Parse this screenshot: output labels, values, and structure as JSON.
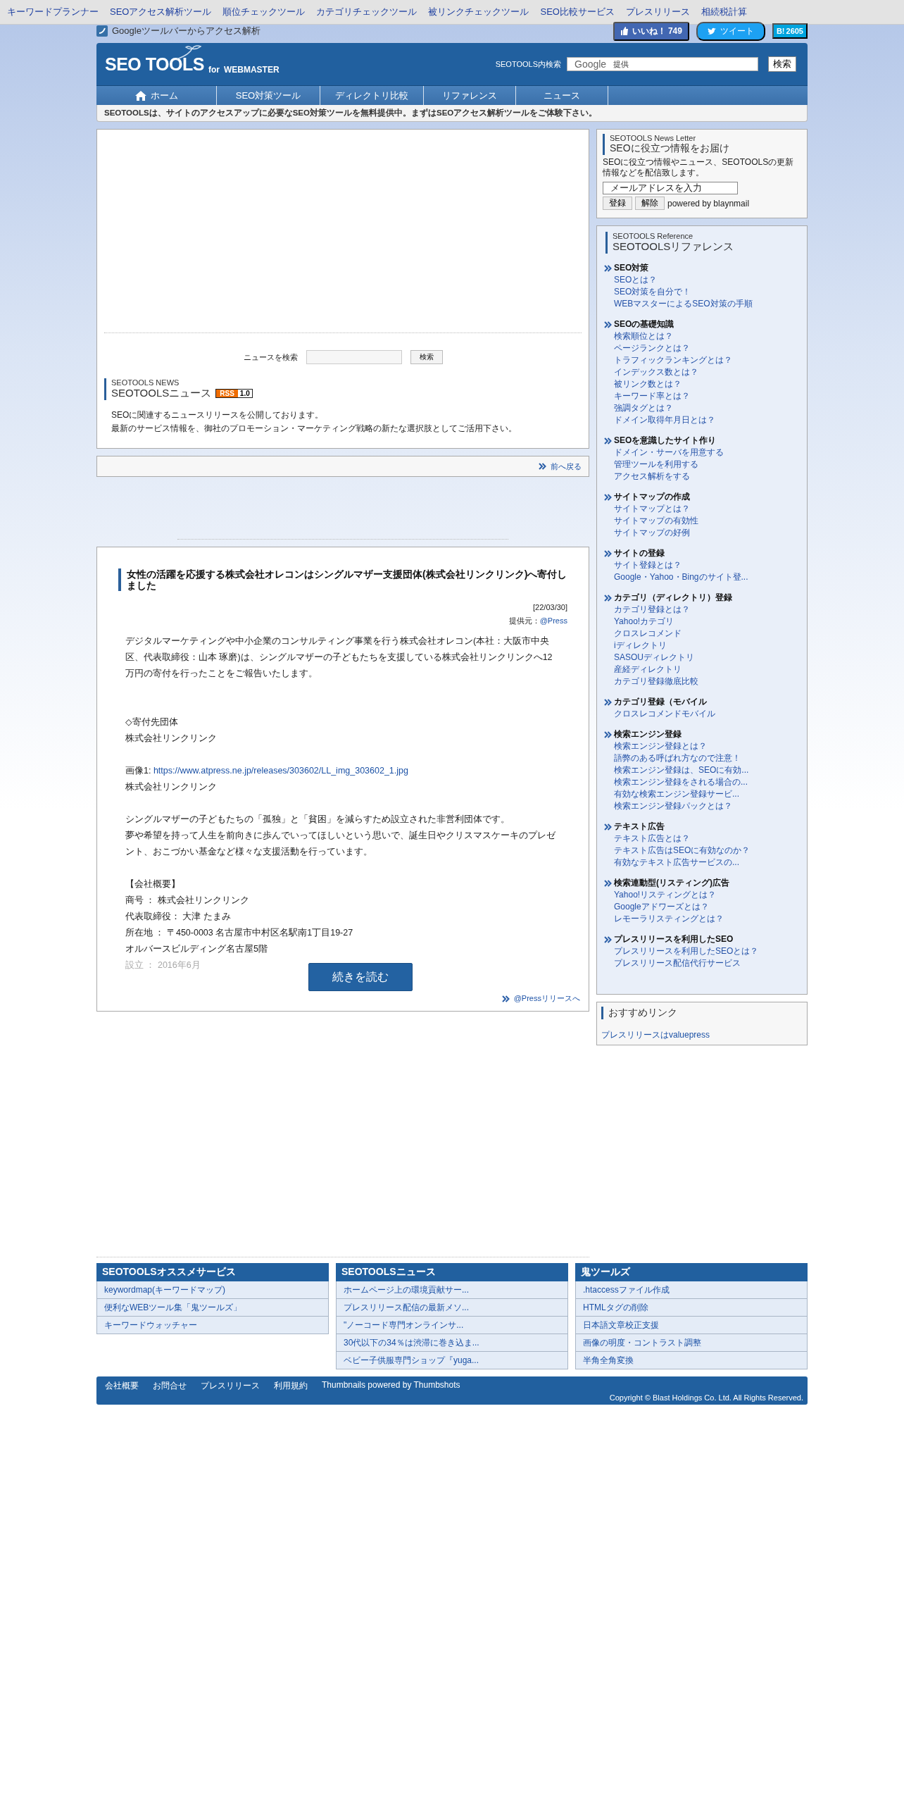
{
  "top_links": [
    "キーワードプランナー",
    "SEOアクセス解析ツール",
    "順位チェックツール",
    "カテゴリチェックツール",
    "被リンクチェックツール",
    "SEO比較サービス",
    "プレスリリース",
    "相続税計算"
  ],
  "toolbar_link": "Googleツールバーからアクセス解析",
  "social": {
    "like_label": "いいね！",
    "like_count": "749",
    "tweet_label": "ツイート",
    "hatena_label": "B!",
    "hatena_count": "2605"
  },
  "header": {
    "logo_title": "SEO TOOLS",
    "logo_for": "for",
    "logo_sub": "WEBMASTER",
    "search_label": "SEOTOOLS内検索",
    "search_brand": "Google",
    "search_hint": "提供",
    "search_button": "検索"
  },
  "nav": [
    {
      "label": "ホーム",
      "kind": "home"
    },
    {
      "label": "SEO対策ツール",
      "kind": "plain"
    },
    {
      "label": "ディレクトリ比較",
      "kind": "plain"
    },
    {
      "label": "リファレンス",
      "kind": "plain"
    },
    {
      "label": "ニュース",
      "kind": "plain"
    }
  ],
  "tagline": "SEOTOOLSは、サイトのアクセスアップに必要なSEO対策ツールを無料提供中。まずはSEOアクセス解析ツールをご体験下さい。",
  "news_search": {
    "label": "ニュースを検索",
    "button": "検索"
  },
  "news_heading": {
    "small": "SEOTOOLS NEWS",
    "title": "SEOTOOLSニュース",
    "rss": "RSS",
    "rss_version": "1.0"
  },
  "news_intro": [
    "SEOに関連するニュースリリースを公開しております。",
    "最新のサービス情報を、御社のプロモーション・マーケティング戦略の新たな選択肢としてご活用下さい。"
  ],
  "pager": "前へ戻る",
  "article": {
    "title": "女性の活躍を応援する株式会社オレコンはシングルマザー支援団体(株式会社リンクリンク)へ寄付しました",
    "date": "[22/03/30]",
    "source_label": "提供元：",
    "source": "@Press",
    "blocks": [
      {
        "lines": [
          {
            "text": "デジタルマーケティングや中小企業のコンサルティング事業を行う株式会社オレコン(本社：大阪市中央区、代表取締役：山本 琢磨)は、シングルマザーの子どもたちを支援している株式会社リンクリンクへ12万円の寄付を行ったことをご報告いたします。",
            "faded": false
          }
        ]
      },
      {
        "lines": [
          {
            "text": "◇寄付先団体",
            "faded": false
          },
          {
            "text": "株式会社リンクリンク",
            "faded": false
          }
        ]
      },
      {
        "lines": [
          {
            "text": "画像1:",
            "link": "https://www.atpress.ne.jp/releases/303602/LL_img_303602_1.jpg",
            "faded": false
          },
          {
            "text": "株式会社リンクリンク",
            "faded": false
          }
        ]
      },
      {
        "lines": [
          {
            "text": "シングルマザーの子どもたちの「孤独」と「貧困」を減らすため設立された非営利団体です。",
            "faded": false
          },
          {
            "text": "夢や希望を持って人生を前向きに歩んでいってほしいという思いで、誕生日やクリスマスケーキのプレゼント、おこづかい基金など様々な支援活動を行っています。",
            "faded": false
          }
        ]
      },
      {
        "lines": [
          {
            "text": "【会社概要】",
            "faded": false
          },
          {
            "text": "商号 ： 株式会社リンクリンク",
            "faded": false
          },
          {
            "text": "代表取締役： 大津 たまみ",
            "faded": false
          },
          {
            "text": "所在地 ： 〒450-0003 名古屋市中村区名駅南1丁目19-27",
            "faded": false
          },
          {
            "text": "オルバースビルディング名古屋5階",
            "faded": false
          },
          {
            "text": "設立 ： 2016年6月",
            "faded": true
          }
        ]
      }
    ],
    "read_more": "続きを読む",
    "release_link": "@Pressリリースへ"
  },
  "newsletter": {
    "small": "SEOTOOLS News Letter",
    "title": "SEOに役立つ情報をお届け",
    "description": "SEOに役立つ情報やニュース、SEOTOOLSの更新情報などを配信致します。",
    "email_value": "メールアドレスを入力",
    "buttons": [
      "登録",
      "解除"
    ],
    "powered": "powered by blaynmail"
  },
  "reference": {
    "small": "SEOTOOLS Reference",
    "title": "SEOTOOLSリファレンス",
    "groups": [
      {
        "heading": "SEO対策",
        "links": [
          "SEOとは？",
          "SEO対策を自分で！",
          "WEBマスターによるSEO対策の手順"
        ]
      },
      {
        "heading": "SEOの基礎知識",
        "links": [
          "検索順位とは？",
          "ページランクとは？",
          "トラフィックランキングとは？",
          "インデックス数とは？",
          "被リンク数とは？",
          "キーワード率とは？",
          "強調タグとは？",
          "ドメイン取得年月日とは？"
        ]
      },
      {
        "heading": "SEOを意識したサイト作り",
        "links": [
          "ドメイン・サーバを用意する",
          "管理ツールを利用する",
          "アクセス解析をする"
        ]
      },
      {
        "heading": "サイトマップの作成",
        "links": [
          "サイトマップとは？",
          "サイトマップの有効性",
          "サイトマップの好例"
        ]
      },
      {
        "heading": "サイトの登録",
        "links": [
          "サイト登録とは？",
          "Google・Yahoo・Bingのサイト登..."
        ]
      },
      {
        "heading": "カテゴリ（ディレクトリ）登録",
        "links": [
          "カテゴリ登録とは？",
          "Yahoo!カテゴリ",
          "クロスレコメンド",
          "iディレクトリ",
          "SASOUディレクトリ",
          "産経ディレクトリ",
          "カテゴリ登録徹底比較"
        ]
      },
      {
        "heading": "カテゴリ登録（モバイル",
        "links": [
          "クロスレコメンドモバイル"
        ]
      },
      {
        "heading": "検索エンジン登録",
        "links": [
          "検索エンジン登録とは？",
          "語弊のある呼ばれ方なので注意！",
          "検索エンジン登録は、SEOに有効...",
          "検索エンジン登録をされる場合の...",
          "有効な検索エンジン登録サービ...",
          "検索エンジン登録パックとは？"
        ]
      },
      {
        "heading": "テキスト広告",
        "links": [
          "テキスト広告とは？",
          "テキスト広告はSEOに有効なのか？",
          "有効なテキスト広告サービスの..."
        ]
      },
      {
        "heading": "検索連動型(リスティング)広告",
        "links": [
          "Yahoo!リスティングとは？",
          "Googleアドワーズとは？",
          "レモーラリスティングとは？"
        ]
      },
      {
        "heading": "プレスリリースを利用したSEO",
        "links": [
          "プレスリリースを利用したSEOとは？",
          "プレスリリース配信代行サービス"
        ]
      }
    ]
  },
  "recommended": {
    "title": "おすすめリンク",
    "links": [
      "プレスリリースはvaluepress"
    ]
  },
  "footer_boxes": [
    {
      "title": "SEOTOOLSオススメサービス",
      "links": [
        "keywordmap(キーワードマップ)",
        "便利なWEBツール集「鬼ツールズ」",
        "キーワードウォッチャー"
      ]
    },
    {
      "title": "SEOTOOLSニュース",
      "links": [
        "ホームページ上の環境貢献サー...",
        "プレスリリース配信の最新メソ...",
        "\"ノーコード専門オンラインサ...",
        "30代以下の34％は渋滞に巻き込ま...",
        "ベビー子供服専門ショップ『yuga..."
      ]
    },
    {
      "title": "鬼ツールズ",
      "links": [
        ".htaccessファイル作成",
        "HTMLタグの削除",
        "日本語文章校正支援",
        "画像の明度・コントラスト調整",
        "半角全角変換"
      ]
    }
  ],
  "bottom_bar": {
    "links": [
      "会社概要",
      "お問合せ",
      "プレスリリース",
      "利用規約"
    ],
    "thumbs": "Thumbnails powered by Thumbshots",
    "copyright": "Copyright © Blast Holdings Co. Ltd. All Rights Reserved."
  }
}
